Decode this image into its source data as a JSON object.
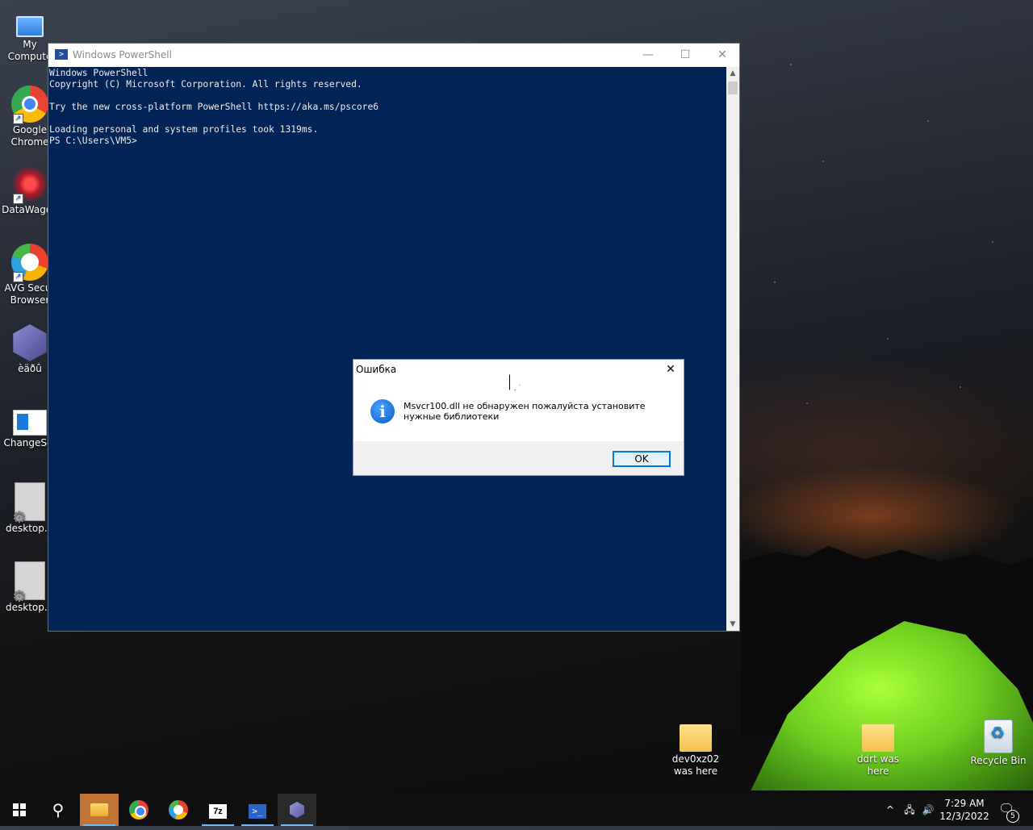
{
  "desktop_icons": [
    {
      "label": "My Compute",
      "icon": "computer-icon"
    },
    {
      "label": "Google Chrome",
      "icon": "chrome-icon"
    },
    {
      "label": "DataWagon",
      "icon": "datawagon-icon"
    },
    {
      "label": "AVG Secur Browser",
      "icon": "avg-browser-icon"
    },
    {
      "label": "èäðû",
      "icon": "cube-app-icon"
    },
    {
      "label": "ChangeScr",
      "icon": "changescreen-icon"
    },
    {
      "label": "desktop.ir",
      "icon": "ini-file-icon"
    },
    {
      "label": "desktop.ir",
      "icon": "ini-file-icon"
    }
  ],
  "desktop_icons_bottom": [
    {
      "label": "dev0xz02 was here",
      "icon": "folder-icon"
    },
    {
      "label": "ddrt was here",
      "icon": "folder-icon"
    },
    {
      "label": "Recycle Bin",
      "icon": "recycle-bin-icon"
    }
  ],
  "powershell": {
    "title": "Windows PowerShell",
    "minimize": "—",
    "maximize": "☐",
    "close": "✕",
    "console_text": "Windows PowerShell\nCopyright (C) Microsoft Corporation. All rights reserved.\n\nTry the new cross-platform PowerShell https://aka.ms/pscore6\n\nLoading personal and system profiles took 1319ms.\nPS C:\\Users\\VM5> "
  },
  "dialog": {
    "title": "Ошибка",
    "close": "✕",
    "icon": "info-icon",
    "info_glyph": "i",
    "message": "Msvcr100.dll не обнаружен пожалуйста установите нужные библиотеки",
    "ok_label": "OK"
  },
  "taskbar": {
    "items": [
      "start-button",
      "search-button",
      "file-explorer",
      "chrome",
      "avg-browser",
      "7zip",
      "powershell",
      "cube-app"
    ],
    "search_glyph": "⚲",
    "sevenzip_label": "7z",
    "ps_label": ">_",
    "tray": {
      "chevron": "^",
      "network": "🖧",
      "volume": "🔊",
      "time": "7:29 AM",
      "date": "12/3/2022",
      "notification_glyph": "🗨",
      "notification_count": "5"
    }
  },
  "colors": {
    "console_bg": "#012456",
    "console_fg": "#eeedf0",
    "taskbar_bg": "#101010",
    "accent": "#0078d7"
  }
}
